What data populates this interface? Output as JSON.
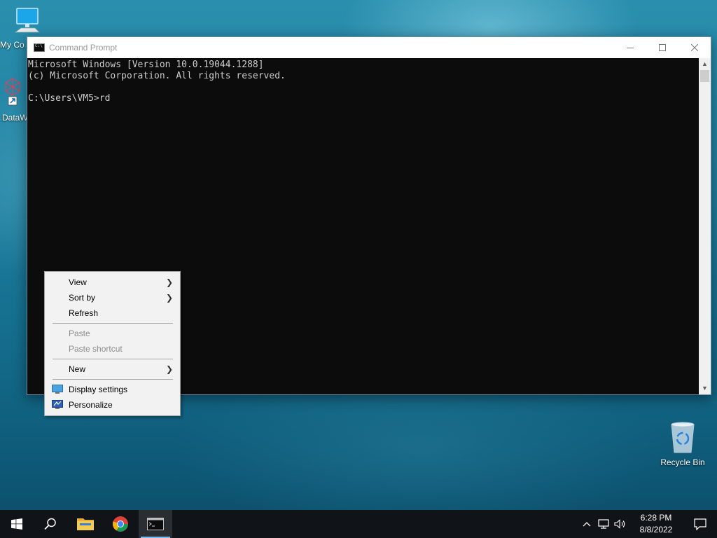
{
  "desktop": {
    "icons": [
      {
        "label": "My Co"
      },
      {
        "label": "DataW"
      },
      {
        "label": "Recycle Bin"
      }
    ]
  },
  "cmd_window": {
    "title": "Command Prompt",
    "console_lines": [
      "Microsoft Windows [Version 10.0.19044.1288]",
      "(c) Microsoft Corporation. All rights reserved.",
      "",
      "C:\\Users\\VM5>rd"
    ],
    "controls": {
      "minimize": "minimize",
      "maximize": "maximize",
      "close": "close"
    }
  },
  "context_menu": {
    "items": [
      {
        "label": "View",
        "submenu": true
      },
      {
        "label": "Sort by",
        "submenu": true
      },
      {
        "label": "Refresh"
      },
      {
        "label": "Paste",
        "disabled": true
      },
      {
        "label": "Paste shortcut",
        "disabled": true
      },
      {
        "label": "New",
        "submenu": true
      },
      {
        "label": "Display settings",
        "icon": "monitor-icon"
      },
      {
        "label": "Personalize",
        "icon": "personalize-icon"
      }
    ]
  },
  "taskbar": {
    "apps": [
      "start-icon",
      "search-icon",
      "file-explorer-icon",
      "chrome-icon",
      "command-prompt-icon"
    ],
    "active_app": "Command Prompt",
    "clock": {
      "time": "6:28 PM",
      "date": "8/8/2022"
    }
  },
  "colors": {
    "console_bg": "#0c0c0c",
    "console_text": "#cccccc",
    "taskbar_bg": "#101418",
    "accent": "#76b9ed"
  }
}
